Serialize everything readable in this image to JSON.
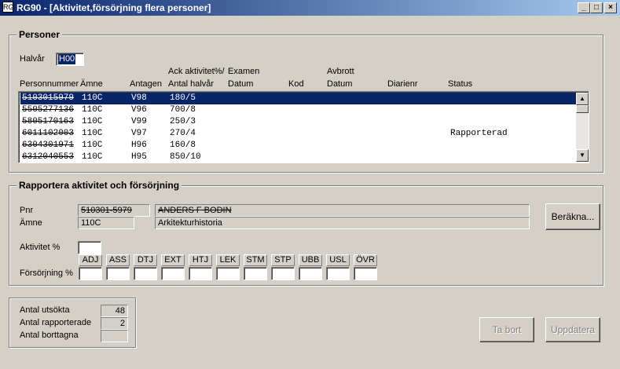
{
  "window": {
    "title": "RG90 - [Aktivitet,försörjning flera personer]",
    "icon_label": "RG",
    "min_glyph": "_",
    "max_glyph": "□",
    "close_glyph": "×"
  },
  "personer": {
    "group_title": "Personer",
    "halvar_label": "Halvår",
    "halvar_value": "H00",
    "headers": {
      "ack_aktivitet": "Ack aktivitet%/",
      "examen": "Examen",
      "avbrott": "Avbrott",
      "personnummer": "Personnummer",
      "amne": "Ämne",
      "antagen": "Antagen",
      "antal_halvar": "Antal halvår",
      "examen_datum": "Datum",
      "kod": "Kod",
      "avbrott_datum": "Datum",
      "diarienr": "Diarienr",
      "status": "Status"
    },
    "rows": [
      {
        "pnr": "5103015979",
        "amne": "110C",
        "antagen": "V98",
        "ack": "180/5",
        "status": "",
        "selected": true
      },
      {
        "pnr": "5505277136",
        "amne": "110C",
        "antagen": "V96",
        "ack": "700/8",
        "status": "",
        "selected": false
      },
      {
        "pnr": "5805170163",
        "amne": "110C",
        "antagen": "V99",
        "ack": "250/3",
        "status": "",
        "selected": false
      },
      {
        "pnr": "6011102003",
        "amne": "110C",
        "antagen": "V97",
        "ack": "270/4",
        "status": "Rapporterad",
        "selected": false
      },
      {
        "pnr": "6304301971",
        "amne": "110C",
        "antagen": "H96",
        "ack": "160/8",
        "status": "",
        "selected": false
      },
      {
        "pnr": "6312040553",
        "amne": "110C",
        "antagen": "H95",
        "ack": "850/10",
        "status": "",
        "selected": false
      }
    ]
  },
  "rapportera": {
    "group_title": "Rapportera aktivitet och försörjning",
    "pnr_label": "Pnr",
    "pnr_value": "510301-5979",
    "name_value": "ANDERS F BODIN",
    "amne_label": "Ämne",
    "amne_value": "110C",
    "amne_name": "Arkitekturhistoria",
    "berakna_label": "Beräkna...",
    "aktivitet_label": "Aktivitet %",
    "forsorjning_label": "Försörjning %",
    "codes": [
      "ADJ",
      "ASS",
      "DTJ",
      "EXT",
      "HTJ",
      "LEK",
      "STM",
      "STP",
      "UBB",
      "USL",
      "ÖVR"
    ]
  },
  "summary": {
    "antal_utsokta_label": "Antal utsökta",
    "antal_utsokta_value": "48",
    "antal_rapporterade_label": "Antal rapporterade",
    "antal_rapporterade_value": "2",
    "antal_borttagna_label": "Antal borttagna",
    "antal_borttagna_value": ""
  },
  "buttons": {
    "ta_bort": "Ta bort",
    "uppdatera": "Uppdatera"
  },
  "colors": {
    "titlebar": "#0a246a",
    "selection": "#0a246a",
    "face": "#d4d0c8"
  }
}
